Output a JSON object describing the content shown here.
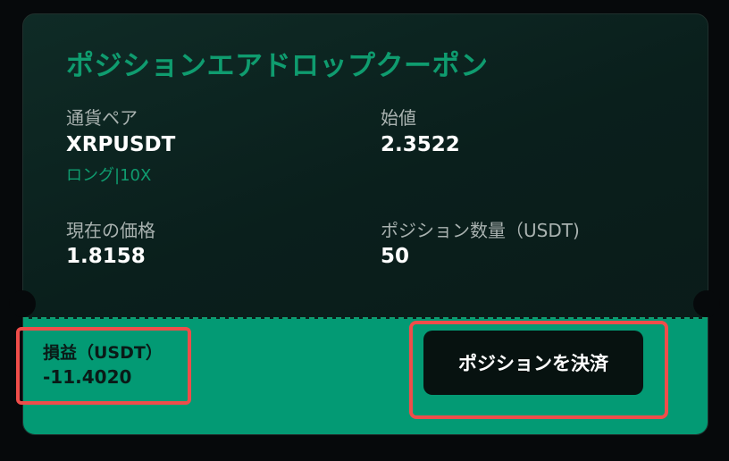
{
  "card": {
    "title": "ポジションエアドロップクーポン"
  },
  "fields": {
    "pair_label": "通貨ペア",
    "pair_value": "XRPUSDT",
    "pair_sub": "ロング|10X",
    "open_label": "始値",
    "open_value": "2.3522",
    "current_label": "現在の価格",
    "current_value": "1.8158",
    "size_label": "ポジション数量（USDT)",
    "size_value": "50"
  },
  "pnl": {
    "label": "損益（USDT）",
    "value": "-11.4020"
  },
  "actions": {
    "close_label": "ポジションを決済"
  },
  "colors": {
    "accent": "#0f9c6f",
    "band": "#039a74",
    "highlight": "#ef4d4a",
    "background": "#06090b"
  }
}
